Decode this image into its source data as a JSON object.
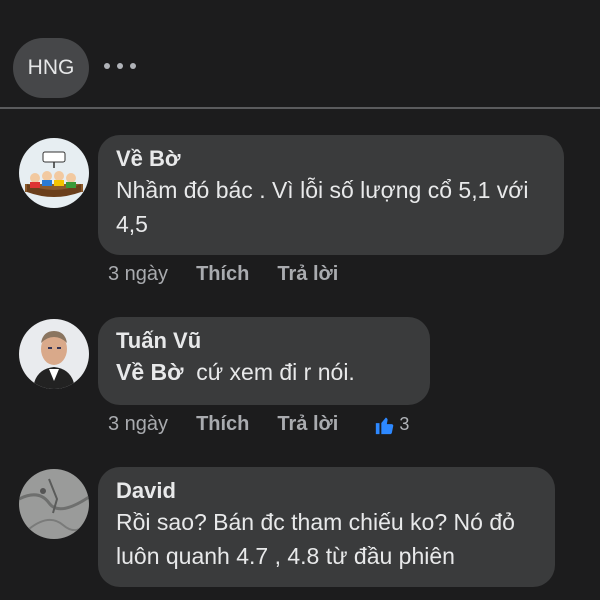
{
  "top": {
    "cut_text": "",
    "group_chip": "HNG",
    "more_icon": "more-horizontal-icon"
  },
  "comments": [
    {
      "author": "Về Bờ",
      "mention": "",
      "text": "Nhầm đó bác . Vì lỗi số lượng cổ 5,1 với 4,5",
      "time": "3 ngày",
      "like_label": "Thích",
      "reply_label": "Trả lời",
      "likes": ""
    },
    {
      "author": "Tuấn Vũ",
      "mention": "Về Bờ",
      "text": "cứ xem đi r nói.",
      "time": "3 ngày",
      "like_label": "Thích",
      "reply_label": "Trả lời",
      "likes": "3"
    },
    {
      "author": "David",
      "mention": "",
      "text": "Rồi sao? Bán đc tham chiếu ko? Nó đỏ luôn quanh 4.7 , 4.8 từ đầu phiên",
      "time": "",
      "like_label": "",
      "reply_label": "",
      "likes": ""
    }
  ],
  "colors": {
    "background": "#1c1c1d",
    "bubble": "#3a3b3c",
    "like_blue": "#2d88ff"
  }
}
